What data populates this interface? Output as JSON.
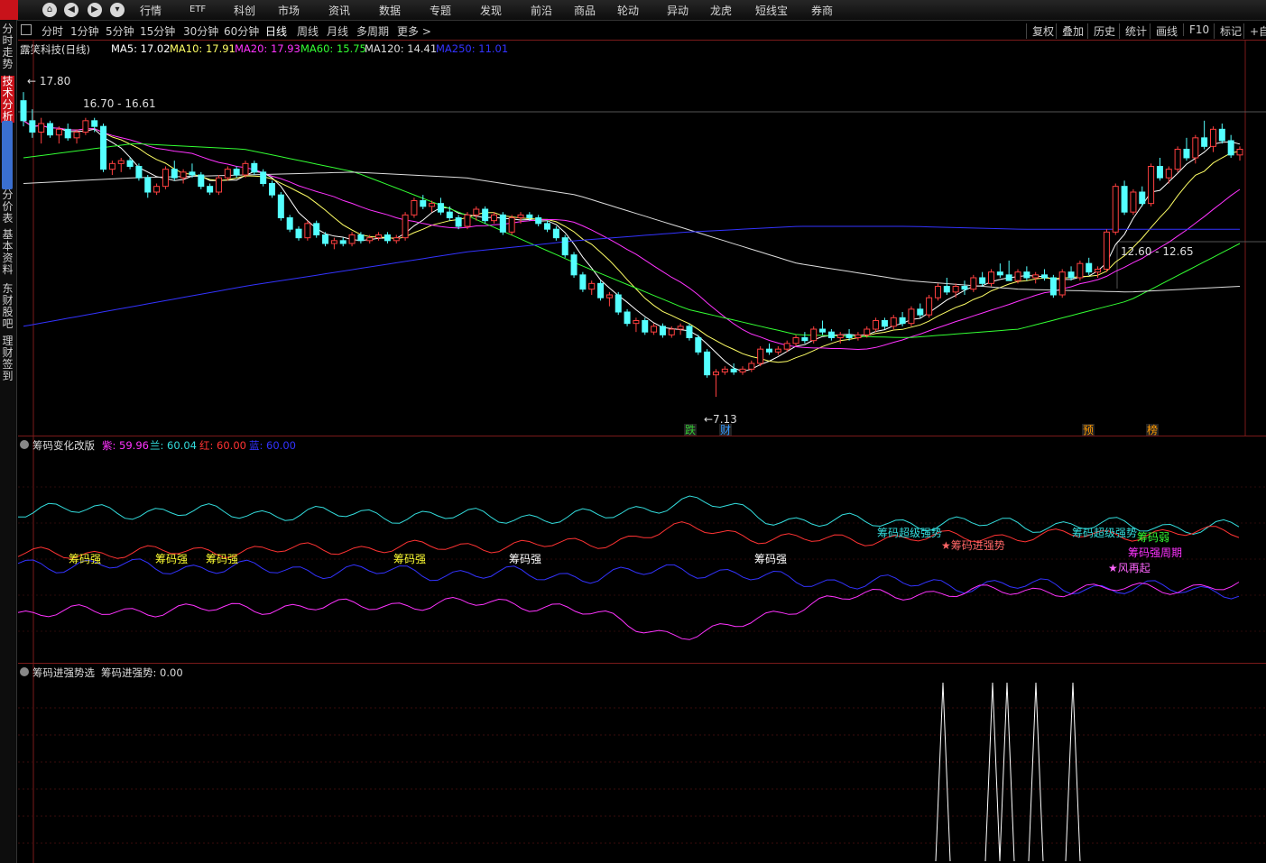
{
  "menu": {
    "items": [
      "行情",
      "ETF",
      "科创",
      "市场",
      "资讯",
      "数据",
      "专题",
      "发现",
      "前沿",
      "商品",
      "轮动",
      "异动",
      "龙虎",
      "短线宝",
      "券商"
    ]
  },
  "nav_icons": [
    "home-icon",
    "back-icon",
    "forward-icon",
    "dropdown-icon"
  ],
  "timeframes": [
    "分时",
    "1分钟",
    "5分钟",
    "15分钟",
    "30分钟",
    "60分钟",
    "日线",
    "周线",
    "月线",
    "多周期",
    "更多 >"
  ],
  "active_timeframe": "日线",
  "tools": [
    "复权",
    "叠加",
    "历史",
    "统计",
    "画线",
    "F10",
    "标记",
    "+自"
  ],
  "sidebar": [
    {
      "label": "分时走势",
      "active": false
    },
    {
      "label": "技术分析",
      "active": true
    },
    {
      "label": "分价表",
      "active": false
    },
    {
      "label": "基本资料",
      "active": false
    },
    {
      "label": "东财股吧",
      "active": false
    },
    {
      "label": "理财签到",
      "active": false
    }
  ],
  "main_chart": {
    "title": "露笑科技(日线)",
    "ma": [
      {
        "label": "MA5: 17.02",
        "color": "#ffffff"
      },
      {
        "label": "MA10: 17.91",
        "color": "#ffff66"
      },
      {
        "label": "MA20: 17.93",
        "color": "#ff33ff"
      },
      {
        "label": "MA60: 15.75",
        "color": "#33ff33"
      },
      {
        "label": "MA120: 14.41",
        "color": "#dddddd"
      },
      {
        "label": "MA250: 11.01",
        "color": "#3333ff"
      }
    ],
    "high_label": "17.80",
    "range_label_1": "16.70 - 16.61",
    "range_label_2": "12.60 - 12.65",
    "low_label": "7.13",
    "event_labels": [
      {
        "text": "跌",
        "color": "#33cc33"
      },
      {
        "text": "财",
        "color": "#3399ff"
      },
      {
        "text": "预",
        "color": "#ff9900"
      },
      {
        "text": "榜",
        "color": "#ff9900"
      }
    ]
  },
  "indicator1": {
    "title": "筹码变化改版",
    "values": [
      {
        "label": "紫: 59.96",
        "color": "#ff33ff"
      },
      {
        "label": "兰: 60.04",
        "color": "#33dddd"
      },
      {
        "label": "红: 60.00",
        "color": "#ff3333"
      },
      {
        "label": "蓝: 60.00",
        "color": "#3333ff"
      }
    ],
    "signal_labels": [
      {
        "text": "筹码强",
        "color": "#ffff33"
      },
      {
        "text": "筹码强",
        "color": "#ffff33"
      },
      {
        "text": "筹码强",
        "color": "#ffff33"
      },
      {
        "text": "筹码强",
        "color": "#ffff33"
      },
      {
        "text": "筹码强",
        "color": "#ffffff"
      },
      {
        "text": "筹码强",
        "color": "#ffffff"
      },
      {
        "text": "筹码超级强势",
        "color": "#33dddd"
      },
      {
        "text": "★筹码进强势",
        "color": "#ff6666"
      },
      {
        "text": "筹码超级强势",
        "color": "#33dddd"
      },
      {
        "text": "筹码弱",
        "color": "#33ff33"
      },
      {
        "text": "筹码强周期",
        "color": "#ff33ff"
      },
      {
        "text": "★风再起",
        "color": "#ff66ff"
      }
    ]
  },
  "indicator2": {
    "title": "筹码进强势选",
    "value_label": "筹码进强势: 0.00"
  },
  "chart_data": {
    "type": "candlestick",
    "title": "露笑科技(日线)",
    "ylim": [
      6.5,
      18.5
    ],
    "candles": [
      [
        17.5,
        17.8,
        16.6,
        16.8
      ],
      [
        16.8,
        17.2,
        16.2,
        16.4
      ],
      [
        16.4,
        16.9,
        16.0,
        16.7
      ],
      [
        16.7,
        16.8,
        16.2,
        16.3
      ],
      [
        16.3,
        16.6,
        16.0,
        16.5
      ],
      [
        16.5,
        16.7,
        16.1,
        16.2
      ],
      [
        16.2,
        16.5,
        16.0,
        16.4
      ],
      [
        16.4,
        16.9,
        16.3,
        16.8
      ],
      [
        16.8,
        16.9,
        16.4,
        16.6
      ],
      [
        16.6,
        16.7,
        15.0,
        15.1
      ],
      [
        15.1,
        15.4,
        14.9,
        15.3
      ],
      [
        15.3,
        15.5,
        15.0,
        15.4
      ],
      [
        15.4,
        15.5,
        15.1,
        15.2
      ],
      [
        15.2,
        15.3,
        14.7,
        14.8
      ],
      [
        14.8,
        14.9,
        14.1,
        14.3
      ],
      [
        14.3,
        14.6,
        14.2,
        14.5
      ],
      [
        14.5,
        15.2,
        14.4,
        15.1
      ],
      [
        15.1,
        15.4,
        14.7,
        14.8
      ],
      [
        14.8,
        15.1,
        14.6,
        15.0
      ],
      [
        15.0,
        15.3,
        14.8,
        14.9
      ],
      [
        14.9,
        15.0,
        14.4,
        14.5
      ],
      [
        14.5,
        14.6,
        14.2,
        14.3
      ],
      [
        14.3,
        14.9,
        14.2,
        14.8
      ],
      [
        14.8,
        15.2,
        14.7,
        15.1
      ],
      [
        15.1,
        15.2,
        14.8,
        14.9
      ],
      [
        14.9,
        15.4,
        14.8,
        15.3
      ],
      [
        15.3,
        15.4,
        14.9,
        15.0
      ],
      [
        15.0,
        15.1,
        14.5,
        14.6
      ],
      [
        14.6,
        14.7,
        14.1,
        14.2
      ],
      [
        14.2,
        14.3,
        13.3,
        13.4
      ],
      [
        13.4,
        13.5,
        12.9,
        13.0
      ],
      [
        13.0,
        13.1,
        12.6,
        12.7
      ],
      [
        12.7,
        13.3,
        12.6,
        13.2
      ],
      [
        13.2,
        13.3,
        12.7,
        12.8
      ],
      [
        12.8,
        12.9,
        12.4,
        12.5
      ],
      [
        12.5,
        12.7,
        12.3,
        12.6
      ],
      [
        12.6,
        12.7,
        12.4,
        12.5
      ],
      [
        12.5,
        12.9,
        12.4,
        12.8
      ],
      [
        12.8,
        12.9,
        12.5,
        12.6
      ],
      [
        12.6,
        12.8,
        12.5,
        12.7
      ],
      [
        12.7,
        12.9,
        12.6,
        12.8
      ],
      [
        12.8,
        12.9,
        12.5,
        12.6
      ],
      [
        12.6,
        12.8,
        12.5,
        12.7
      ],
      [
        12.7,
        13.6,
        12.6,
        13.5
      ],
      [
        13.5,
        14.1,
        13.4,
        14.0
      ],
      [
        14.0,
        14.2,
        13.7,
        13.8
      ],
      [
        13.8,
        14.0,
        13.6,
        13.9
      ],
      [
        13.9,
        14.1,
        13.5,
        13.6
      ],
      [
        13.6,
        13.8,
        13.3,
        13.4
      ],
      [
        13.4,
        13.5,
        13.0,
        13.1
      ],
      [
        13.1,
        13.6,
        13.0,
        13.5
      ],
      [
        13.5,
        13.8,
        13.3,
        13.7
      ],
      [
        13.7,
        13.8,
        13.2,
        13.3
      ],
      [
        13.3,
        13.6,
        13.2,
        13.5
      ],
      [
        13.5,
        13.6,
        12.8,
        12.9
      ],
      [
        12.9,
        13.5,
        12.8,
        13.4
      ],
      [
        13.4,
        13.6,
        13.2,
        13.5
      ],
      [
        13.5,
        13.6,
        13.3,
        13.4
      ],
      [
        13.4,
        13.5,
        13.1,
        13.2
      ],
      [
        13.2,
        13.3,
        12.9,
        13.0
      ],
      [
        13.0,
        13.1,
        12.6,
        12.7
      ],
      [
        12.7,
        12.8,
        12.0,
        12.1
      ],
      [
        12.1,
        12.2,
        11.3,
        11.4
      ],
      [
        11.4,
        11.5,
        10.8,
        10.9
      ],
      [
        10.9,
        11.2,
        10.7,
        11.1
      ],
      [
        11.1,
        11.2,
        10.5,
        10.6
      ],
      [
        10.6,
        10.8,
        10.3,
        10.7
      ],
      [
        10.7,
        10.8,
        10.0,
        10.1
      ],
      [
        10.1,
        10.2,
        9.6,
        9.7
      ],
      [
        9.7,
        9.9,
        9.4,
        9.8
      ],
      [
        9.8,
        9.9,
        9.3,
        9.4
      ],
      [
        9.4,
        9.7,
        9.3,
        9.6
      ],
      [
        9.6,
        9.7,
        9.2,
        9.3
      ],
      [
        9.3,
        9.6,
        9.2,
        9.5
      ],
      [
        9.5,
        9.7,
        9.3,
        9.6
      ],
      [
        9.6,
        9.7,
        9.1,
        9.2
      ],
      [
        9.2,
        9.3,
        8.6,
        8.7
      ],
      [
        8.7,
        8.8,
        7.8,
        7.9
      ],
      [
        7.9,
        8.1,
        7.13,
        8.0
      ],
      [
        8.0,
        8.2,
        7.9,
        8.1
      ],
      [
        8.1,
        8.3,
        7.9,
        8.0
      ],
      [
        8.0,
        8.2,
        7.9,
        8.1
      ],
      [
        8.1,
        8.4,
        8.0,
        8.3
      ],
      [
        8.3,
        8.9,
        8.2,
        8.8
      ],
      [
        8.8,
        9.0,
        8.6,
        8.7
      ],
      [
        8.7,
        8.9,
        8.6,
        8.8
      ],
      [
        8.8,
        9.1,
        8.7,
        9.0
      ],
      [
        9.0,
        9.3,
        8.9,
        9.2
      ],
      [
        9.2,
        9.4,
        9.0,
        9.1
      ],
      [
        9.1,
        9.6,
        9.0,
        9.5
      ],
      [
        9.5,
        9.8,
        9.3,
        9.4
      ],
      [
        9.4,
        9.5,
        9.1,
        9.2
      ],
      [
        9.2,
        9.4,
        9.0,
        9.3
      ],
      [
        9.3,
        9.5,
        9.1,
        9.2
      ],
      [
        9.2,
        9.4,
        9.1,
        9.3
      ],
      [
        9.3,
        9.6,
        9.2,
        9.5
      ],
      [
        9.5,
        9.9,
        9.4,
        9.8
      ],
      [
        9.8,
        9.9,
        9.5,
        9.6
      ],
      [
        9.6,
        10.0,
        9.5,
        9.9
      ],
      [
        9.9,
        10.1,
        9.6,
        9.7
      ],
      [
        9.7,
        10.3,
        9.6,
        10.2
      ],
      [
        10.2,
        10.4,
        9.9,
        10.0
      ],
      [
        10.0,
        10.7,
        9.9,
        10.6
      ],
      [
        10.6,
        11.1,
        10.5,
        11.0
      ],
      [
        11.0,
        11.3,
        10.7,
        10.8
      ],
      [
        10.8,
        11.1,
        10.6,
        11.0
      ],
      [
        11.0,
        11.2,
        10.7,
        10.9
      ],
      [
        10.9,
        11.4,
        10.8,
        11.3
      ],
      [
        11.3,
        11.5,
        11.0,
        11.1
      ],
      [
        11.1,
        11.6,
        11.0,
        11.5
      ],
      [
        11.5,
        11.8,
        11.3,
        11.4
      ],
      [
        11.4,
        11.9,
        11.3,
        11.2
      ],
      [
        11.2,
        11.6,
        11.1,
        11.5
      ],
      [
        11.5,
        11.7,
        11.2,
        11.3
      ],
      [
        11.3,
        11.5,
        11.1,
        11.4
      ],
      [
        11.4,
        11.6,
        11.2,
        11.3
      ],
      [
        11.3,
        11.4,
        10.6,
        10.7
      ],
      [
        10.7,
        11.6,
        10.6,
        11.5
      ],
      [
        11.5,
        11.7,
        11.2,
        11.3
      ],
      [
        11.3,
        11.9,
        11.2,
        11.8
      ],
      [
        11.8,
        12.0,
        11.4,
        11.5
      ],
      [
        11.5,
        11.7,
        11.3,
        11.6
      ],
      [
        11.6,
        13.0,
        11.5,
        12.9
      ],
      [
        12.9,
        14.6,
        12.8,
        14.5
      ],
      [
        14.5,
        14.7,
        13.5,
        13.6
      ],
      [
        13.6,
        14.4,
        13.5,
        14.3
      ],
      [
        14.3,
        14.5,
        13.8,
        13.9
      ],
      [
        13.9,
        15.3,
        13.8,
        15.2
      ],
      [
        15.2,
        15.5,
        14.7,
        14.8
      ],
      [
        14.8,
        15.2,
        14.6,
        15.1
      ],
      [
        15.1,
        15.9,
        15.0,
        15.8
      ],
      [
        15.8,
        16.2,
        15.4,
        15.5
      ],
      [
        15.5,
        16.3,
        15.3,
        16.2
      ],
      [
        16.2,
        16.8,
        15.8,
        15.9
      ],
      [
        15.9,
        16.6,
        15.7,
        16.5
      ],
      [
        16.5,
        16.7,
        16.0,
        16.1
      ],
      [
        16.1,
        16.3,
        15.5,
        15.6
      ],
      [
        15.6,
        15.9,
        15.4,
        15.8
      ]
    ],
    "ma_periods": [
      5,
      10,
      20,
      60,
      120,
      250
    ]
  }
}
